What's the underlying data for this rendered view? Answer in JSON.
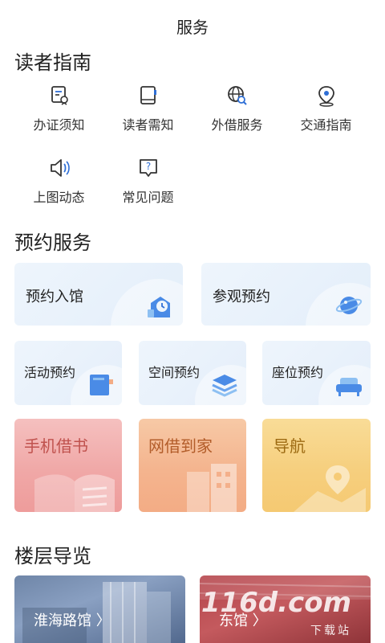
{
  "header": {
    "title": "服务"
  },
  "reader_guide": {
    "title": "读者指南",
    "items": [
      {
        "label": "办证须知",
        "icon": "certificate-icon"
      },
      {
        "label": "读者需知",
        "icon": "notebook-icon"
      },
      {
        "label": "外借服务",
        "icon": "globe-search-icon"
      },
      {
        "label": "交通指南",
        "icon": "location-pin-icon"
      },
      {
        "label": "上图动态",
        "icon": "speaker-icon"
      },
      {
        "label": "常见问题",
        "icon": "question-icon"
      }
    ]
  },
  "reservation": {
    "title": "预约服务",
    "large": [
      {
        "label": "预约入馆",
        "icon": "building-clock-icon"
      },
      {
        "label": "参观预约",
        "icon": "planet-icon"
      }
    ],
    "small": [
      {
        "label": "活动预约",
        "icon": "book-icon"
      },
      {
        "label": "空间预约",
        "icon": "layers-icon"
      },
      {
        "label": "座位预约",
        "icon": "sofa-icon"
      }
    ],
    "colored": [
      {
        "label": "手机借书",
        "icon": "open-book-icon",
        "color": "#f0a8a7"
      },
      {
        "label": "网借到家",
        "icon": "buildings-icon",
        "color": "#f4b48e"
      },
      {
        "label": "导航",
        "icon": "map-pin-icon",
        "color": "#f6cf7e"
      }
    ]
  },
  "floor_guide": {
    "title": "楼层导览",
    "cards": [
      {
        "label": "淮海路馆 〉"
      },
      {
        "label": "东馆 〉"
      }
    ],
    "watermark": {
      "main": "116d.com",
      "sub": "下载站"
    }
  },
  "colors": {
    "accent": "#2f6fd6",
    "card_bg": "#e8f1fb"
  }
}
